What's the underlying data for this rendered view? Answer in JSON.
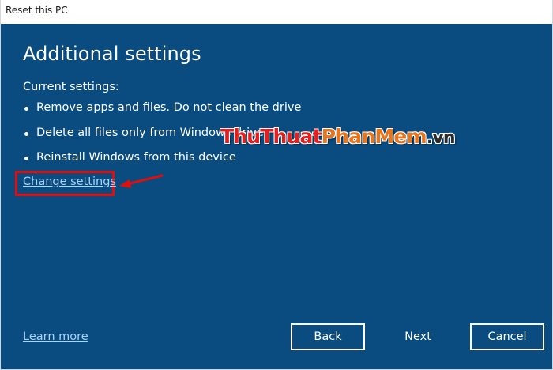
{
  "window": {
    "title": "Reset this PC"
  },
  "page": {
    "heading": "Additional settings",
    "current_settings_label": "Current settings:",
    "settings": [
      "Remove apps and files. Do not clean the drive",
      "Delete all files only from Windows drive",
      "Reinstall Windows from this device"
    ],
    "change_settings_link": "Change settings",
    "learn_more_link": "Learn more"
  },
  "buttons": {
    "back": "Back",
    "next": "Next",
    "cancel": "Cancel"
  },
  "watermark": {
    "part1": "Thu",
    "part2": "Thuat",
    "part3": "PhanMem",
    "part4": ".vn"
  },
  "colors": {
    "background": "#0a4c80",
    "link": "#a8d4ff",
    "highlight": "#e10e0e"
  }
}
